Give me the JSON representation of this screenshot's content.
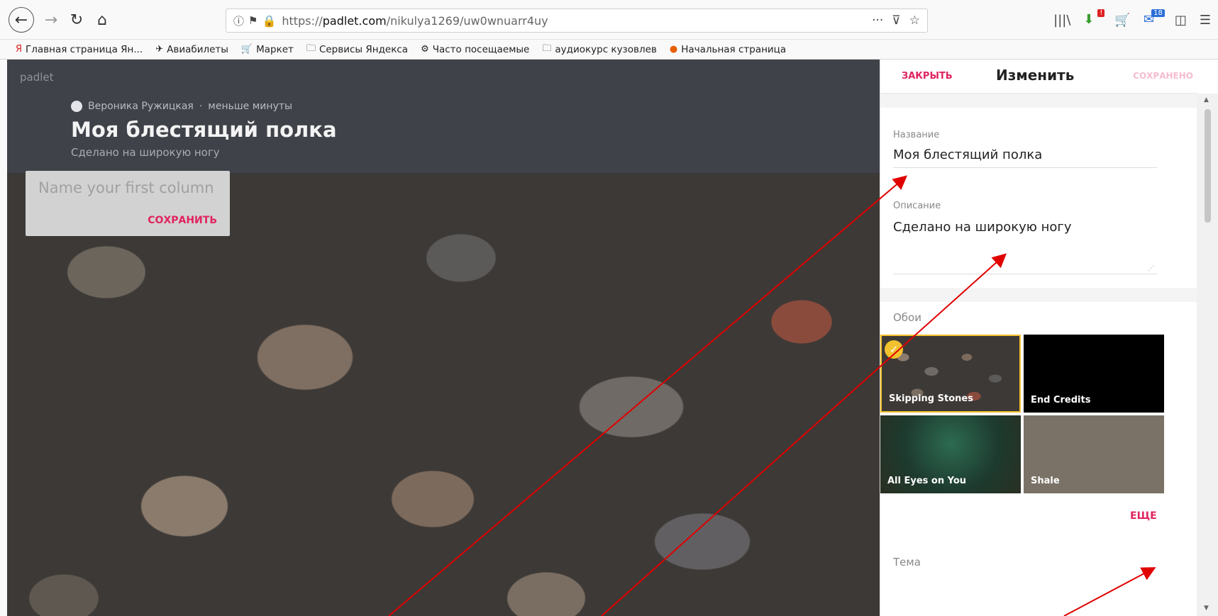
{
  "browser": {
    "url_prefix": "https://",
    "url_domain": "padlet.com",
    "url_path": "/nikulya1269/uw0wnuarr4uy",
    "page_actions": "···",
    "badge_red": "!",
    "badge_blue": "18"
  },
  "bookmarks": [
    {
      "label": "Главная страница Ян...",
      "icon": "yandex-icon"
    },
    {
      "label": "Авиабилеты",
      "icon": "plane-icon"
    },
    {
      "label": "Маркет",
      "icon": "cart-icon"
    },
    {
      "label": "Сервисы Яндекса",
      "icon": "folder-icon"
    },
    {
      "label": "Часто посещаемые",
      "icon": "gear-icon"
    },
    {
      "label": "аудиокурс кузовлев",
      "icon": "folder-icon"
    },
    {
      "label": "Начальная страница",
      "icon": "firefox-icon"
    }
  ],
  "padlet": {
    "logo": "padlet",
    "author": "Вероника Ружицкая",
    "time": "меньше минуты",
    "title": "Моя блестящий полка",
    "subtitle": "Сделано на широкую ногу",
    "column_placeholder": "Name your first column",
    "column_save": "СОХРАНИТЬ"
  },
  "panel": {
    "close": "ЗАКРЫТЬ",
    "title": "Изменить",
    "saved": "СОХРАНЕНО",
    "name_label": "Название",
    "name_value": "Моя блестящий полка",
    "desc_label": "Описание",
    "desc_value": "Сделано на широкую ногу",
    "wallpaper_label": "Обои",
    "wallpapers": [
      {
        "name": "Skipping Stones",
        "selected": true
      },
      {
        "name": "End Credits",
        "selected": false
      },
      {
        "name": "All Eyes on You",
        "selected": false
      },
      {
        "name": "Shale",
        "selected": false
      }
    ],
    "more": "ЕЩЕ",
    "theme_label": "Тема"
  },
  "colors": {
    "accent": "#e0245e",
    "header_bg": "#3f4249",
    "selected_border": "#f2c12e",
    "arrow": "#e00000"
  }
}
